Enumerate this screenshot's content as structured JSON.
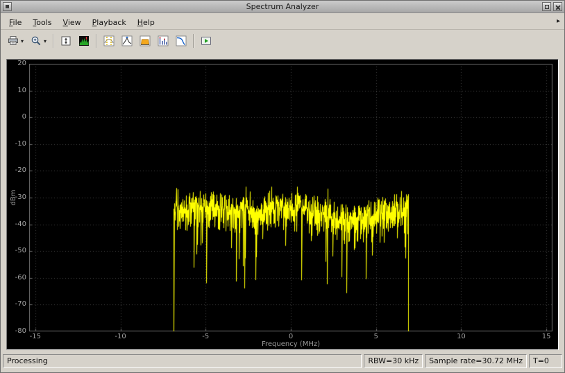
{
  "window": {
    "title": "Spectrum Analyzer"
  },
  "icons": {
    "dropdown_caret": "▾",
    "menu_overflow": "▸"
  },
  "menu": {
    "items": [
      {
        "label": "File",
        "mnemonic": 0
      },
      {
        "label": "Tools",
        "mnemonic": 0
      },
      {
        "label": "View",
        "mnemonic": 0
      },
      {
        "label": "Playback",
        "mnemonic": 0
      },
      {
        "label": "Help",
        "mnemonic": 0
      }
    ]
  },
  "toolbar": {
    "buttons": [
      {
        "name": "print-button",
        "icon": "printer-icon",
        "dropdown": true
      },
      {
        "name": "zoom-button",
        "icon": "zoom-in-icon",
        "dropdown": true
      },
      {
        "name": "scale-axes-button",
        "icon": "fit-view-icon",
        "group_start": true
      },
      {
        "name": "spectrum-settings-button",
        "icon": "spectrum-settings-icon"
      },
      {
        "name": "cursor-measurements-button",
        "icon": "cursor-measurements-icon",
        "group_start": true
      },
      {
        "name": "peak-finder-button",
        "icon": "peak-finder-icon"
      },
      {
        "name": "channel-measurements-button",
        "icon": "channel-measurements-icon"
      },
      {
        "name": "distortion-measurements-button",
        "icon": "distortion-measurements-icon"
      },
      {
        "name": "ccdf-measurements-button",
        "icon": "ccdf-icon"
      },
      {
        "name": "playback-options-button",
        "icon": "playback-icon",
        "group_start": true
      }
    ]
  },
  "chart_data": {
    "type": "line",
    "title": "",
    "xlabel": "Frequency (MHz)",
    "ylabel": "dBm",
    "xlim": [
      -15.36,
      15.36
    ],
    "ylim": [
      -80,
      20
    ],
    "x_ticks": [
      -15,
      -10,
      -5,
      0,
      5,
      10,
      15
    ],
    "y_ticks": [
      20,
      10,
      0,
      -10,
      -20,
      -30,
      -40,
      -50,
      -60,
      -70,
      -80
    ],
    "grid": true,
    "legend": false,
    "background": "#000000",
    "grid_color": "#484848",
    "frame_color": "#6e6e6e",
    "tick_color": "#a2a2a2",
    "series": [
      {
        "name": "spectrum",
        "color": "#ffff00",
        "band_mhz": [
          -6.9,
          6.9
        ],
        "top_envelope_dbm": -33,
        "envelope_spread_db": 7,
        "typical_depth_db": [
          2,
          10
        ],
        "deep_notch_prob": 0.16,
        "deep_notch_extra_db": 24,
        "max_peak_dbm": -26,
        "edge_floor_dbm": -80,
        "seed": 20731
      }
    ]
  },
  "status": {
    "left": "Processing",
    "cells": [
      {
        "name": "rbw",
        "text": "RBW=30 kHz"
      },
      {
        "name": "sample-rate",
        "text": "Sample rate=30.72 MHz"
      },
      {
        "name": "time",
        "text": "T=0"
      }
    ]
  }
}
